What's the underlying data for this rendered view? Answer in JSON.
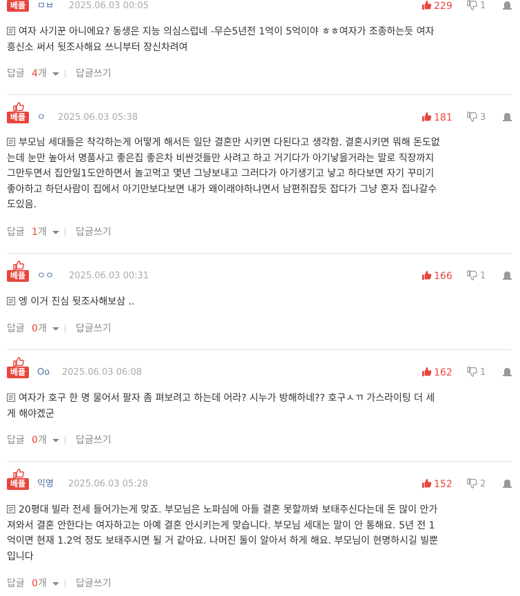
{
  "labels": {
    "best": "베플",
    "reply": "답글",
    "reply_unit": "개",
    "write_reply": "답글쓰기"
  },
  "colors": {
    "accent": "#e8453c",
    "nick": "#4a6fa5",
    "muted": "#aaaaaa"
  },
  "comments": [
    {
      "nick": "ㅁㅂ",
      "date": "2025.06.03 00:05",
      "up": "229",
      "down": "1",
      "lines": [
        "여자 사기꾼 아니에요? 동생은 지능 의심스럽네 -무슨5년전 1억이 5억이야 ㅎㅎ여자가 조종하는듯 여자",
        "흥신소 써서 뒷조사해요 쓰니부터 장신차려여"
      ],
      "replies": "4"
    },
    {
      "nick": "ㅇ",
      "date": "2025.06.03 05:38",
      "up": "181",
      "down": "3",
      "lines": [
        "부모님 세대들은 착각하는게 어떻게 해서든 일단 결혼만 시키면 다된다고 생각함. 결혼시키면 뭐해 돈도없",
        "는데 눈만 높아서 명품사고 좋은집 좋은차 비싼것들만 사려고 하고 거기다가 아기낳을거라는 말로 직장까지",
        "그만두면서 집안일1도안하면서 놀고먹고 몇년 그냥보내고 그러다가 아기생기고 낳고 하다보면 자기 꾸미기",
        "좋아하고 하던사람이 집에서 아기만보다보면 내가 왜이래야하냐면서 남편쥐잡듯 잡다가 그냥 혼자 집나갈수",
        "도있음."
      ],
      "replies": "1"
    },
    {
      "nick": "ㅇㅇ",
      "date": "2025.06.03 00:31",
      "up": "166",
      "down": "1",
      "lines": [
        "엥 이거 진심 뒷조사해보삼 .."
      ],
      "replies": "0"
    },
    {
      "nick": "Oo",
      "date": "2025.06.03 06:08",
      "up": "162",
      "down": "1",
      "lines": [
        "여자가 호구 한 명 물어서 팔자 좀 펴보려고 하는데 어라? 시누가 방해하네?? 호구ㅅㄲ 가스라이팅 더 세",
        "게 해야겠군"
      ],
      "replies": "0"
    },
    {
      "nick": "익명",
      "date": "2025.06.03 05:28",
      "up": "152",
      "down": "2",
      "lines": [
        "20평대 빌라 전세 들어가는게 맞죠. 부모님은 노파심에 아들 결혼 못할까봐 보태주신다는데 돈 많이 안가",
        "져와서 결혼 안한다는 여자하고는 아예 결혼 안시키는게 맞습니다. 부모님 세대는 말이 안 통해요. 5년 전 1",
        "억이면 현재 1.2억 정도 보태주시면 될 거 같아요. 나머진 둘이 알아서 하게 해요. 부모님이 현명하시길 빌뿐",
        "입니다"
      ],
      "replies": "0"
    }
  ]
}
